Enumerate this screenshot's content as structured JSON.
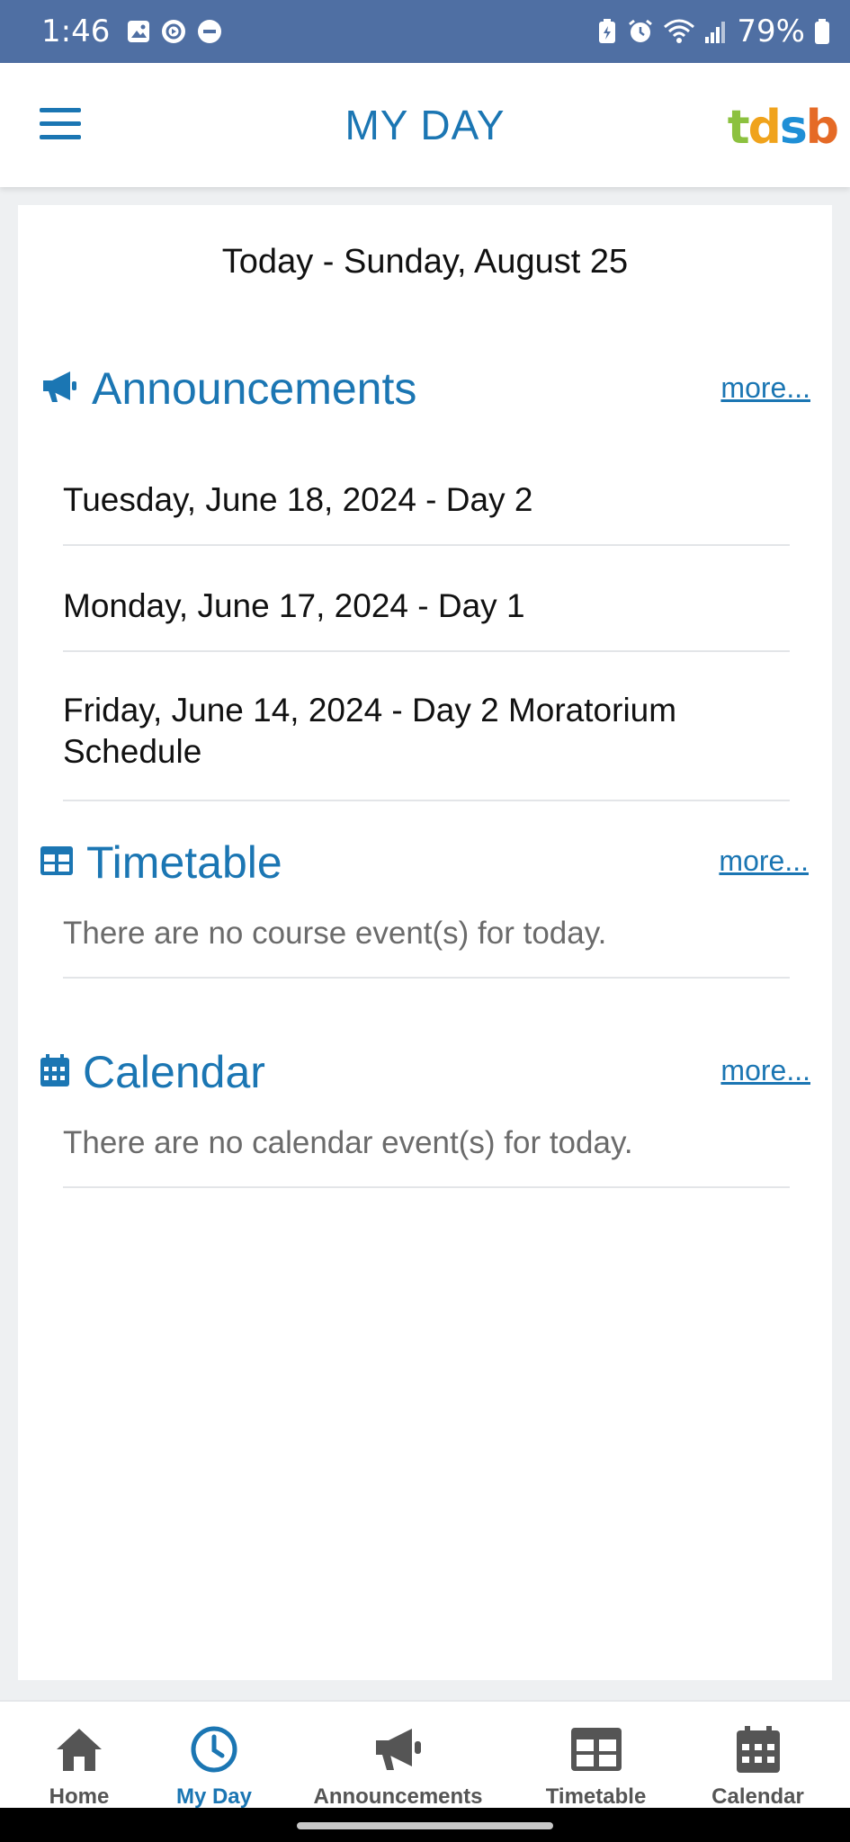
{
  "status_bar": {
    "time": "1:46",
    "battery_percent": "79%",
    "icons": [
      "gallery-icon",
      "sync-icon",
      "do-not-disturb-icon",
      "battery-saver-icon",
      "alarm-icon",
      "wifi-icon",
      "signal-icon",
      "battery-icon"
    ]
  },
  "header": {
    "title": "MY DAY",
    "logo": {
      "text_1": "t",
      "text_2": "d",
      "text_3": "s",
      "text_4": "b"
    },
    "menu_icon": "hamburger-menu-icon"
  },
  "main": {
    "today_label": "Today - Sunday, August 25",
    "announcements": {
      "title": "Announcements",
      "more_label": "more...",
      "icon": "megaphone-icon",
      "items": [
        {
          "label": "Tuesday, June 18, 2024 - Day 2"
        },
        {
          "label": "Monday, June 17, 2024 - Day 1"
        },
        {
          "label": "Friday, June 14, 2024 - Day 2 Moratorium Schedule"
        }
      ]
    },
    "timetable": {
      "title": "Timetable",
      "more_label": "more...",
      "icon": "table-icon",
      "empty_text": "There are no course event(s) for today."
    },
    "calendar": {
      "title": "Calendar",
      "more_label": "more...",
      "icon": "calendar-icon",
      "empty_text": "There are no calendar event(s) for today."
    }
  },
  "bottom_nav": {
    "items": [
      {
        "label": "Home",
        "icon": "home-icon",
        "active": false
      },
      {
        "label": "My Day",
        "icon": "clock-icon",
        "active": true
      },
      {
        "label": "Announcements",
        "icon": "megaphone-icon",
        "active": false
      },
      {
        "label": "Timetable",
        "icon": "table-icon",
        "active": false
      },
      {
        "label": "Calendar",
        "icon": "calendar-icon",
        "active": false
      }
    ]
  },
  "colors": {
    "accent": "#1b76b3",
    "status_bar": "#4f6fa3",
    "nav_inactive": "#555555"
  }
}
